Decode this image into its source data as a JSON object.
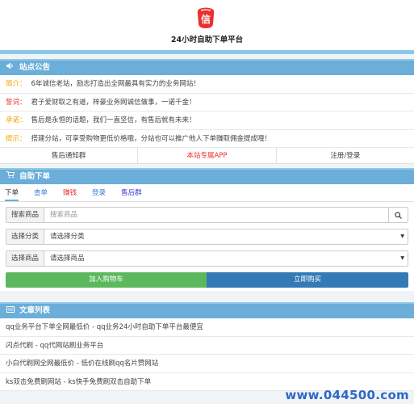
{
  "site": {
    "title": "24小时自助下单平台",
    "logo_char": "信",
    "logo_color": "#e8322e"
  },
  "notice": {
    "heading": "站点公告",
    "heading_icon": "volume-icon",
    "rows": [
      {
        "tag": "简介：",
        "text": "6年诚信老站，励志打造出全网最具有实力的业务网站！"
      },
      {
        "tag": "誓词：",
        "text": "君子爱财取之有道，梓豪业务网诚信做事，一诺千金！"
      },
      {
        "tag": "承诺：",
        "text": "售后是永恒的话题，我们一直坚信，有售后就有未来！"
      },
      {
        "tag": "提示：",
        "text": "搭建分站，可享受购物更低价格哦，分站也可以推广他人下单赚取佣金提成哦！"
      }
    ],
    "links": [
      "售后通知群",
      "本站专属APP",
      "注册/登录"
    ]
  },
  "order": {
    "heading": "自助下单",
    "heading_icon": "cart-icon",
    "tabs": [
      "下单",
      "查单",
      "赚钱",
      "登录",
      "售后群"
    ],
    "search_label": "搜索商品",
    "search_placeholder": "搜索商品",
    "category_label": "选择分类",
    "category_value": "请选择分类",
    "product_label": "选择商品",
    "product_value": "请选择商品",
    "add_cart": "加入购物车",
    "buy_now": "立即购买"
  },
  "articles": {
    "heading": "文章列表",
    "heading_icon": "list-icon",
    "items": [
      "qq业务平台下单全网最低价 - qq业务24小时自助下单平台最便宜",
      "闪点代刷 - qq代网站刷业务平台",
      "小白代刷网全网最低价 - 低价在线刷qq名片赞网站",
      "ks双击免费刷网站 - ks快手免费刷双击自助下单"
    ]
  },
  "watermark": "www.044500.com"
}
